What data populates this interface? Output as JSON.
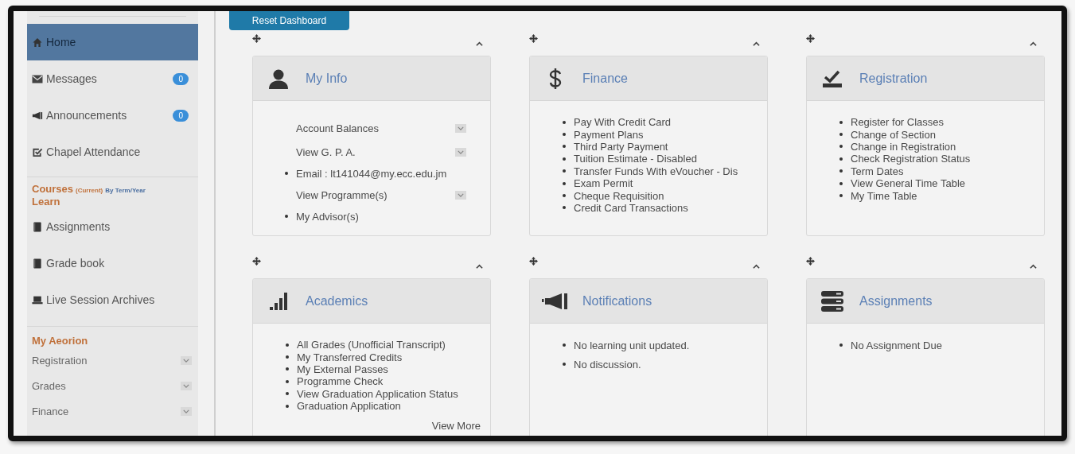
{
  "sidebar": {
    "nav_items": [
      {
        "label": "Home",
        "selected": true
      },
      {
        "label": "Messages",
        "badge": "0",
        "selected": false
      },
      {
        "label": "Announcements",
        "badge": "0",
        "selected": false
      },
      {
        "label": "Chapel Attendance",
        "selected": false
      }
    ],
    "courses": {
      "title": "Courses",
      "current": "(Current)",
      "by_term": "By Term/Year",
      "subtitle": "Learn"
    },
    "learn_items": [
      {
        "label": "Assignments"
      },
      {
        "label": "Grade book"
      },
      {
        "label": "Live Session Archives"
      }
    ],
    "my_aeorion": {
      "title": "My Aeorion",
      "items": [
        {
          "label": "Registration"
        },
        {
          "label": "Grades"
        },
        {
          "label": "Finance"
        }
      ]
    }
  },
  "reset_button": "Reset Dashboard",
  "widgets": [
    {
      "title": "My Info",
      "kind": "info",
      "items": [
        {
          "kind": "dropdown",
          "text": "Account Balances"
        },
        {
          "kind": "dropdown",
          "text": "View G. P. A."
        },
        {
          "kind": "bullet",
          "text": "Email : lt141044@my.ecc.edu.jm"
        },
        {
          "kind": "dropdown",
          "text": "View Programme(s)"
        },
        {
          "kind": "bullet",
          "text": "My Advisor(s)"
        }
      ]
    },
    {
      "title": "Finance",
      "kind": "links",
      "items": [
        {
          "text": "Pay With Credit Card"
        },
        {
          "text": "Payment Plans"
        },
        {
          "text": "Third Party Payment"
        },
        {
          "text": "Tuition Estimate - Disabled"
        },
        {
          "text": "Transfer Funds With eVoucher - Dis"
        },
        {
          "text": "Exam Permit"
        },
        {
          "text": "Cheque Requisition"
        },
        {
          "text": "Credit Card Transactions"
        }
      ]
    },
    {
      "title": "Registration",
      "kind": "links",
      "items": [
        {
          "text": "Register for Classes"
        },
        {
          "text": "Change of Section"
        },
        {
          "text": "Change in Registration"
        },
        {
          "text": "Check Registration Status"
        },
        {
          "text": "Term Dates"
        },
        {
          "text": "View General Time Table"
        },
        {
          "text": "My Time Table"
        }
      ]
    },
    {
      "title": "Academics",
      "kind": "links",
      "items": [
        {
          "text": "All Grades (Unofficial Transcript)"
        },
        {
          "text": "My Transferred Credits"
        },
        {
          "text": "My External Passes"
        },
        {
          "text": "Programme Check"
        },
        {
          "text": "View Graduation Application Status"
        },
        {
          "text": "Graduation Application"
        }
      ],
      "more_link": "View More"
    },
    {
      "title": "Notifications",
      "kind": "notices",
      "items": [
        {
          "text": "No learning unit updated."
        },
        {
          "text": "No discussion."
        }
      ]
    },
    {
      "title": "Assignments",
      "kind": "notices",
      "items": [
        {
          "text": "No Assignment Due"
        }
      ]
    }
  ]
}
